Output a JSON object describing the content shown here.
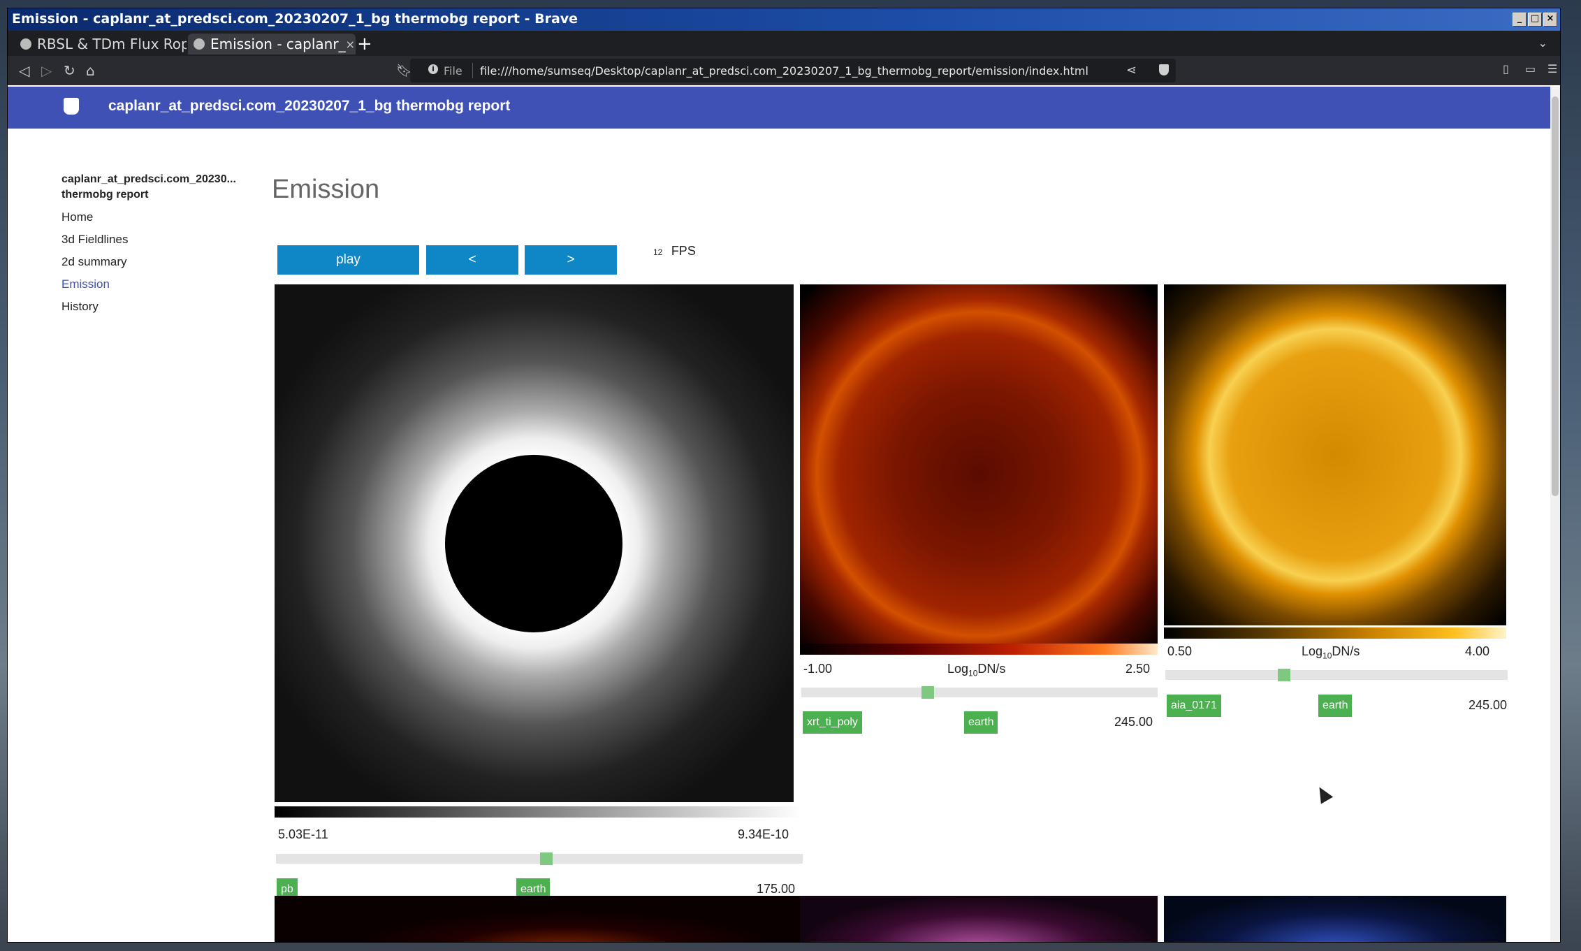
{
  "window": {
    "title": "Emission - caplanr_at_predsci.com_20230207_1_bg thermobg report - Brave",
    "controls": [
      "_",
      "□",
      "×"
    ]
  },
  "tabs": [
    {
      "label": "RBSL & TDm Flux Rop",
      "active": false
    },
    {
      "label": "Emission - caplanr_",
      "active": true
    }
  ],
  "tab_close": "×",
  "new_tab": "+",
  "address_bar": {
    "scheme_label": "File",
    "url": "file:///home/sumseq/Desktop/caplanr_at_predsci.com_20230207_1_bg_thermobg_report/emission/index.html"
  },
  "header": {
    "title": "caplanr_at_predsci.com_20230207_1_bg thermobg report"
  },
  "sidebar": {
    "title_line1": "caplanr_at_predsci.com_20230...",
    "title_line2": "thermobg report",
    "items": [
      {
        "label": "Home",
        "active": false
      },
      {
        "label": "3d Fieldlines",
        "active": false
      },
      {
        "label": "2d summary",
        "active": false
      },
      {
        "label": "Emission",
        "active": true
      },
      {
        "label": "History",
        "active": false
      }
    ]
  },
  "main": {
    "title": "Emission",
    "controls": {
      "play": "play",
      "prev": "<",
      "next": ">",
      "fps_value": "12",
      "fps_label": "FPS"
    },
    "panels": [
      {
        "min": "5.03E-11",
        "max": "9.34E-10",
        "unit": "",
        "slider_pos": 0.5,
        "instrument": "pb",
        "observer": "earth",
        "angle": "175.00",
        "colormap": "grayscale"
      },
      {
        "min": "-1.00",
        "max": "2.50",
        "unit_prefix": "Log",
        "unit_sub": "10",
        "unit_suffix": "DN/s",
        "slider_pos": 0.33,
        "instrument": "xrt_ti_poly",
        "observer": "earth",
        "angle": "245.00",
        "colormap": "red-heat"
      },
      {
        "min": "0.50",
        "max": "4.00",
        "unit_prefix": "Log",
        "unit_sub": "10",
        "unit_suffix": "DN/s",
        "slider_pos": 0.33,
        "instrument": "aia_0171",
        "observer": "earth",
        "angle": "245.00",
        "colormap": "gold"
      }
    ]
  },
  "colors": {
    "header": "#3f51b5",
    "button": "#0f86c6",
    "tag": "#4caf50",
    "slider_thumb": "#7fc87f",
    "active_link": "#3f51b5"
  }
}
